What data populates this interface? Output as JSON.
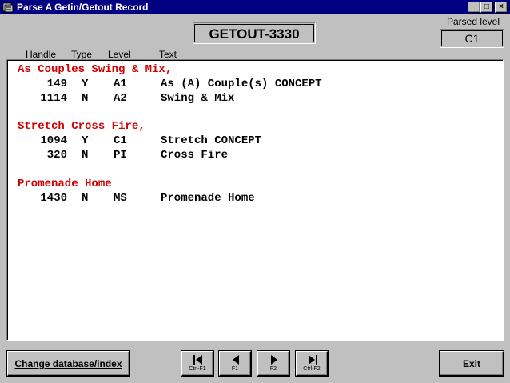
{
  "window": {
    "title": "Parse A Getin/Getout Record",
    "controls": {
      "minimize": "_",
      "maximize": "□",
      "close": "×"
    }
  },
  "header": {
    "record_id": "GETOUT-3330",
    "parsed_level_label": "Parsed level",
    "parsed_level_value": "C1"
  },
  "columns": {
    "handle": "Handle",
    "type": "Type",
    "level": "Level",
    "text": "Text"
  },
  "list": {
    "lines": [
      {
        "kind": "header",
        "text": "As Couples Swing & Mix,"
      },
      {
        "kind": "entry",
        "handle": "149",
        "type": "Y",
        "level": "A1",
        "text": "As (A) Couple(s) CONCEPT"
      },
      {
        "kind": "entry",
        "handle": "1114",
        "type": "N",
        "level": "A2",
        "text": "Swing & Mix"
      },
      {
        "kind": "blank"
      },
      {
        "kind": "header",
        "text": "Stretch Cross Fire,"
      },
      {
        "kind": "entry",
        "handle": "1094",
        "type": "Y",
        "level": "C1",
        "text": "Stretch CONCEPT"
      },
      {
        "kind": "entry",
        "handle": "320",
        "type": "N",
        "level": "PI",
        "text": "Cross Fire"
      },
      {
        "kind": "blank"
      },
      {
        "kind": "header",
        "text": "Promenade Home"
      },
      {
        "kind": "entry",
        "handle": "1430",
        "type": "N",
        "level": "MS",
        "text": "Promenade Home"
      }
    ]
  },
  "buttons": {
    "change_database": "Change database/index",
    "exit": "Exit",
    "nav": {
      "first": {
        "icon": "first-record-icon",
        "key": "Ctrl-F1"
      },
      "prev": {
        "icon": "previous-record-icon",
        "key": "F1"
      },
      "next": {
        "icon": "next-record-icon",
        "key": "F2"
      },
      "last": {
        "icon": "last-record-icon",
        "key": "Ctrl-F2"
      }
    }
  }
}
